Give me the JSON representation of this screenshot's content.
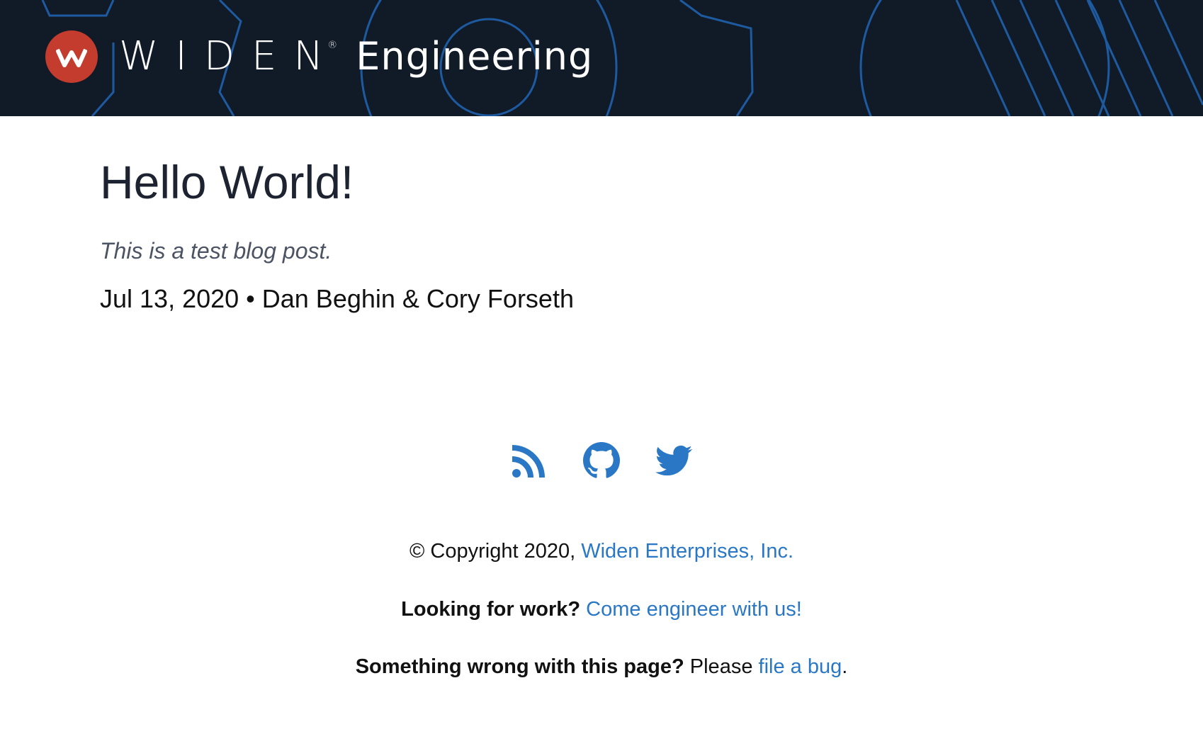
{
  "header": {
    "logo_letter": "W",
    "wordmark": "WIDEN",
    "registered_mark": "®",
    "site_suffix": "Engineering",
    "colors": {
      "background": "#111a27",
      "art_lines": "#1e5aa0",
      "logo_badge": "#c43c2e"
    }
  },
  "post": {
    "title": "Hello World!",
    "description": "This is a test blog post.",
    "meta": "Jul 13, 2020 • Dan Beghin & Cory Forseth"
  },
  "social": {
    "icons": [
      "rss-icon",
      "github-icon",
      "twitter-icon"
    ],
    "accent": "#2a78c5"
  },
  "footer": {
    "copyright_text": "© Copyright 2020, ",
    "company_link": "Widen Enterprises, Inc.",
    "jobs_prompt": "Looking for work?",
    "jobs_link": "Come engineer with us!",
    "bug_prompt": "Something wrong with this page?",
    "bug_please": " Please ",
    "bug_link": "file a bug",
    "bug_period": "."
  }
}
